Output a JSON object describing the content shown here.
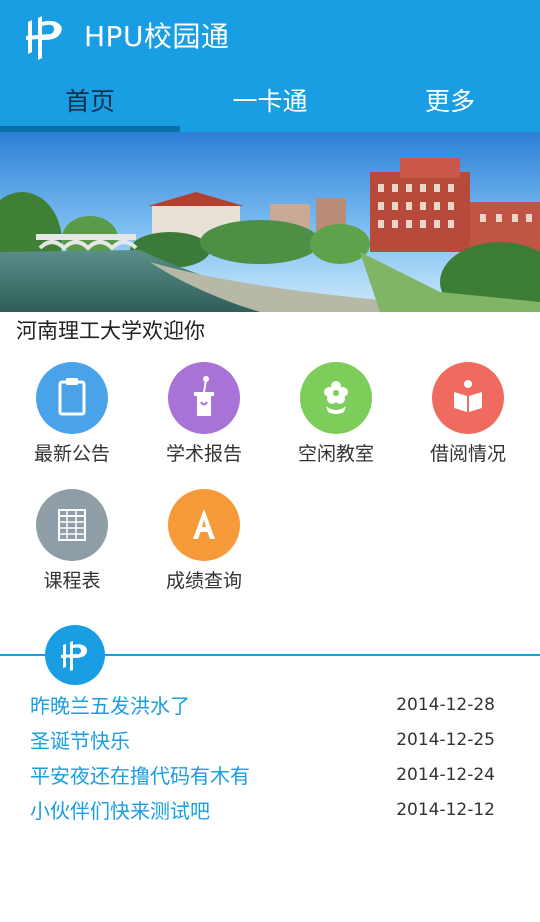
{
  "app": {
    "title": "HPU校园通",
    "brand_color": "#1a9ee3"
  },
  "tabs": [
    {
      "label": "首页",
      "active": true
    },
    {
      "label": "一卡通",
      "active": false
    },
    {
      "label": "更多",
      "active": false
    }
  ],
  "banner": {
    "caption": "河南理工大学欢迎你"
  },
  "grid": [
    {
      "label": "最新公告",
      "icon": "clipboard-icon",
      "color": "#4aa3e8"
    },
    {
      "label": "学术报告",
      "icon": "podium-icon",
      "color": "#a872d6"
    },
    {
      "label": "空闲教室",
      "icon": "flower-icon",
      "color": "#7ccd5a"
    },
    {
      "label": "借阅情况",
      "icon": "book-icon",
      "color": "#f06b5f"
    },
    {
      "label": "课程表",
      "icon": "table-icon",
      "color": "#8f9ea6"
    },
    {
      "label": "成绩查询",
      "icon": "letter-a-icon",
      "color": "#f79b3a"
    }
  ],
  "news": [
    {
      "title": "昨晚兰五发洪水了",
      "date": "2014-12-28"
    },
    {
      "title": "圣诞节快乐",
      "date": "2014-12-25"
    },
    {
      "title": "平安夜还在撸代码有木有",
      "date": "2014-12-24"
    },
    {
      "title": "小伙伴们快来测试吧",
      "date": "2014-12-12"
    }
  ]
}
